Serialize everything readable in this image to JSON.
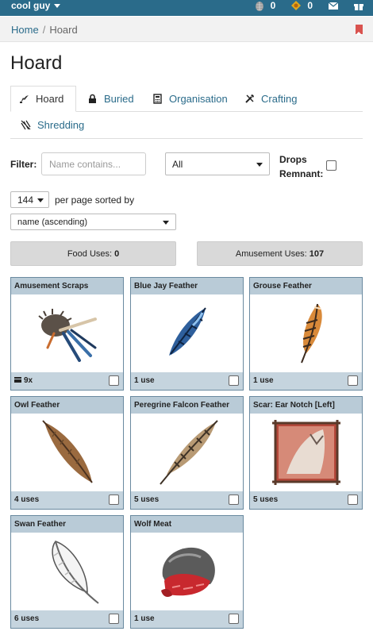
{
  "navbar": {
    "username": "cool guy",
    "currency_1": "0",
    "currency_2": "0",
    "icons": [
      "pinecone-icon",
      "gold-icon",
      "mail-icon",
      "gift-icon"
    ]
  },
  "breadcrumb": {
    "home": "Home",
    "separator": "/",
    "current": "Hoard"
  },
  "page_title": "Hoard",
  "tabs": [
    {
      "label": "Hoard",
      "icon": "hoard-icon",
      "active": true
    },
    {
      "label": "Buried",
      "icon": "lock-icon"
    },
    {
      "label": "Organisation",
      "icon": "calculator-icon"
    },
    {
      "label": "Crafting",
      "icon": "tools-icon"
    },
    {
      "label": "Shredding",
      "icon": "shred-icon"
    }
  ],
  "filter": {
    "label": "Filter:",
    "name_placeholder": "Name contains...",
    "category_value": "All",
    "drops_remnant_label": [
      "Drops",
      "Remnant:"
    ]
  },
  "paging": {
    "per_page": "144",
    "per_page_text": "per page sorted by",
    "sort_value": "name (ascending)"
  },
  "stats": {
    "food_label": "Food Uses:",
    "food_value": "0",
    "amusement_label": "Amusement Uses:",
    "amusement_value": "107"
  },
  "items": [
    {
      "name": "Amusement Scraps",
      "uses": "9x",
      "stacked": true
    },
    {
      "name": "Blue Jay Feather",
      "uses": "1 use"
    },
    {
      "name": "Grouse Feather",
      "uses": "1 use"
    },
    {
      "name": "Owl Feather",
      "uses": "4 uses"
    },
    {
      "name": "Peregrine Falcon Feather",
      "uses": "5 uses"
    },
    {
      "name": "Scar: Ear Notch [Left]",
      "uses": "5 uses"
    },
    {
      "name": "Swan Feather",
      "uses": "6 uses"
    },
    {
      "name": "Wolf Meat",
      "uses": "1 use"
    }
  ],
  "colors": {
    "navbar": "#2a6b8a",
    "link": "#2a6b8a",
    "card_header": "#b9cbd7",
    "card_border": "#6a8aa0",
    "bookmark": "#d9534f"
  }
}
